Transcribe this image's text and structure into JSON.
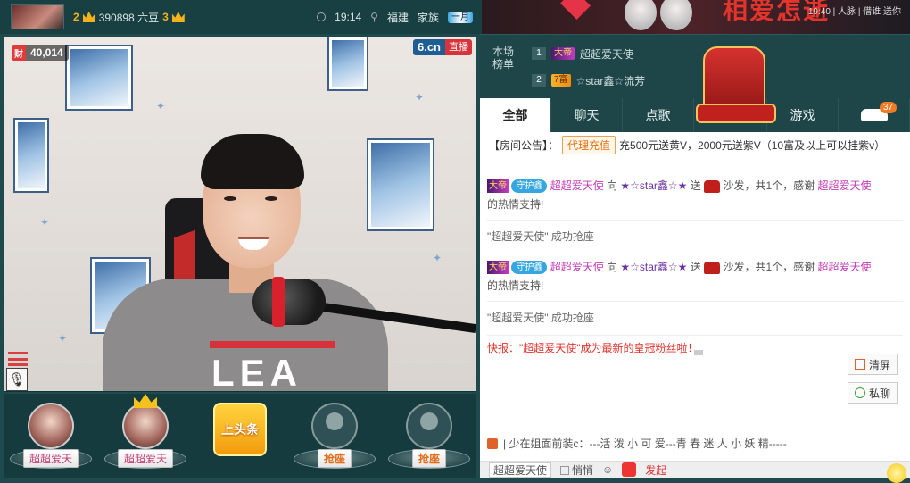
{
  "top": {
    "level_left": "2",
    "coins": "390898 六豆",
    "level_right": "3",
    "time": "19:14",
    "location": "福建",
    "family_label": "家族",
    "family_badge": "一月"
  },
  "banner": {
    "headline": "相爱怎逝",
    "small": "19:40 | 人脉 | 借谁 送你"
  },
  "video": {
    "wealth_tag": "财",
    "wealth_value": "40,014",
    "brand": "6.cn",
    "live": "直播",
    "shirt": "LEA"
  },
  "seats": [
    {
      "label": "超超爱天",
      "type": "user",
      "crown": false
    },
    {
      "label": "超超爱天",
      "type": "user",
      "crown": true
    },
    {
      "label": "上头条",
      "type": "headline"
    },
    {
      "label": "抢座",
      "type": "empty"
    },
    {
      "label": "抢座",
      "type": "empty"
    }
  ],
  "rank": {
    "label": "本场榜单",
    "rows": [
      {
        "num": "1",
        "badge": "大帝",
        "name": "超超爱天使"
      },
      {
        "num": "2",
        "badge": "7富",
        "name": "☆star鑫☆流芳"
      }
    ]
  },
  "tabs": [
    "全部",
    "聊天",
    "点歌",
    "",
    "游戏"
  ],
  "car_badge": "37",
  "notice": {
    "prefix": "【房间公告】：",
    "tag": "代理充值",
    "text": "充500元送黄V，2000元送紫V（10富及以上可以挂紫v）"
  },
  "chat": [
    {
      "kind": "gift",
      "badge": "大帝",
      "guard": "守护鑫",
      "from": "超超爱天使",
      "to_word": "向",
      "target": "★☆star鑫☆★",
      "send": "送",
      "gift": "沙发，共1个，感谢",
      "thanks_name": "超超爱天使",
      "tail": "的热情支持!"
    },
    {
      "kind": "sys",
      "text": "\"超超爱天使\" 成功抢座"
    },
    {
      "kind": "gift",
      "badge": "大帝",
      "guard": "守护鑫",
      "from": "超超爱天使",
      "to_word": "向",
      "target": "★☆star鑫☆★",
      "send": "送",
      "gift": "沙发，共1个，感谢",
      "thanks_name": "超超爱天使",
      "tail": "的热情支持!"
    },
    {
      "kind": "sys",
      "text": "\"超超爱天使\" 成功抢座"
    },
    {
      "kind": "flash",
      "text": "快报：\"超超爱天使\"成为最新的皇冠粉丝啦！"
    }
  ],
  "tools": {
    "clear": "清屏",
    "private": "私聊"
  },
  "fly": "| 少在姐面前装c：---活 泼 小 可 爱---青 春 迷 人 小 妖 精-----",
  "bottom": {
    "user": "超超爱天使",
    "quiet": "悄悄",
    "red": "发起"
  }
}
